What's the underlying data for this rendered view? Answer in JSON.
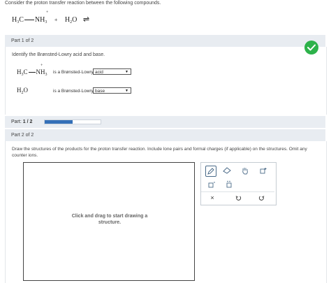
{
  "intro": {
    "question": "Consider the proton transfer reaction between the following compounds."
  },
  "reaction": {
    "charge": "+",
    "reactant1": {
      "h3c": "H",
      "sub1": "3",
      "c": "C",
      "nh": "NH",
      "sub2": "3"
    },
    "plus": "+",
    "reactant2": {
      "h": "H",
      "sub": "2",
      "o": "O"
    },
    "equilibrium_symbol": "⇌"
  },
  "part1": {
    "header": "Part 1 of 2",
    "complete": true,
    "prompt": "Identify the Brønsted-Lowry acid and base.",
    "row1": {
      "charge": "+",
      "h": "H",
      "sub1": "3",
      "c": "C",
      "nh": "NH",
      "sub2": "3",
      "label": "is a Brønsted-Lowry",
      "selected": "acid"
    },
    "row2": {
      "h": "H",
      "sub": "2",
      "o": "O",
      "label": "is a Brønsted-Lowry",
      "selected": "base"
    }
  },
  "progress": {
    "label": "Part:",
    "value": "1 / 2",
    "fraction": 0.5,
    "fill_color": "#3470b8"
  },
  "part2": {
    "header": "Part 2 of 2",
    "prompt": "Draw the structures of the products for the proton transfer reaction. Include lone pairs and formal charges (if applicable) on the structures. Omit any counter ions.",
    "canvas_hint": "Click and drag to start drawing a structure.",
    "tools": [
      "pencil-icon",
      "eraser-icon",
      "hand-icon",
      "add-charge-icon",
      "add-box-icon",
      "lone-pair-icon",
      "clear-icon",
      "undo-icon",
      "redo-icon"
    ],
    "clear_symbol": "×"
  },
  "colors": {
    "panel_header": "#e8ecf1",
    "check_green": "#2db24a",
    "accent_blue": "#3470b8"
  }
}
